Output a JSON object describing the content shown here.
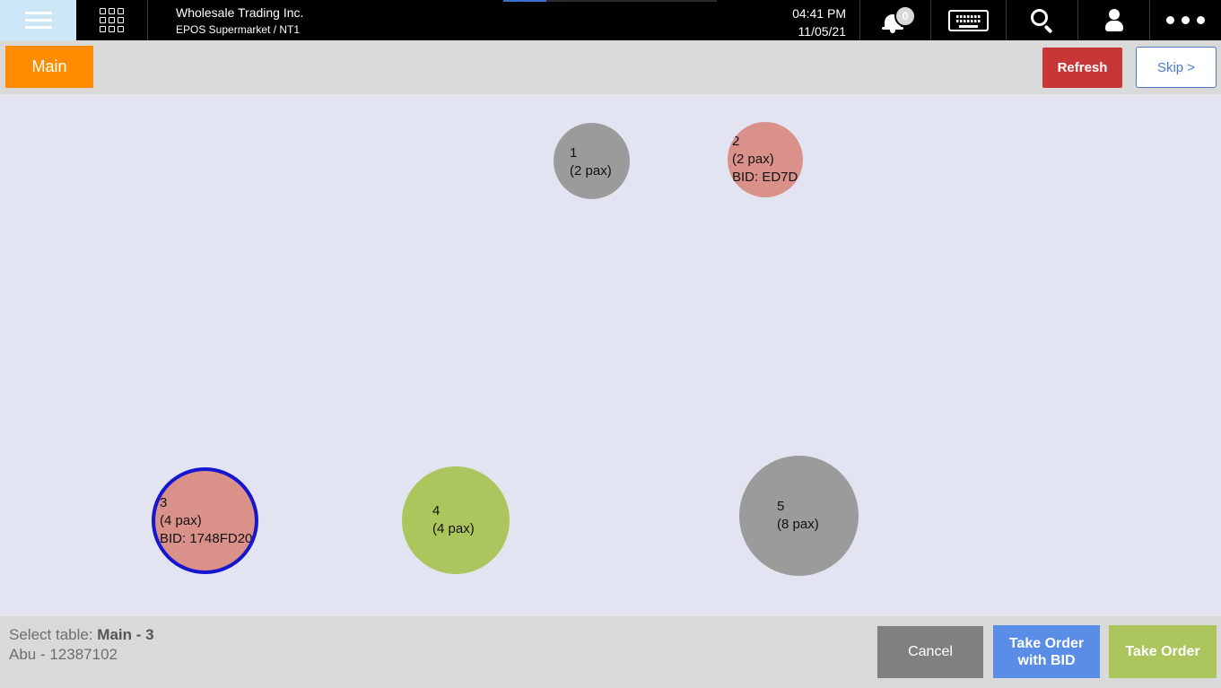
{
  "topbar": {
    "company_name": "Wholesale Trading Inc.",
    "company_subtitle": "EPOS Supermarket / NT1",
    "time": "04:41 PM",
    "date": "11/05/21",
    "notification_count": "0",
    "progress_fraction": 0.2,
    "icons": [
      "hamburger-icon",
      "app-grid-icon",
      "bell-icon",
      "keyboard-icon",
      "search-icon",
      "user-icon",
      "more-icon"
    ]
  },
  "area_bar": {
    "area_label": "Main",
    "refresh_label": "Refresh",
    "skip_label": "Skip >"
  },
  "tables": [
    {
      "number": "1",
      "pax": "(2 pax)",
      "bid": "",
      "status": "free"
    },
    {
      "number": "2",
      "pax": "(2 pax)",
      "bid": "BID: ED7D",
      "status": "occupied"
    },
    {
      "number": "3",
      "pax": "(4 pax)",
      "bid": "BID: 1748FD20",
      "status": "occupied",
      "selected": true
    },
    {
      "number": "4",
      "pax": "(4 pax)",
      "bid": "",
      "status": "available"
    },
    {
      "number": "5",
      "pax": "(8 pax)",
      "bid": "",
      "status": "free"
    }
  ],
  "footer": {
    "select_prefix": "Select table: ",
    "selected_table": "Main - 3",
    "customer": "Abu - 12387102",
    "cancel_label": "Cancel",
    "take_order_bid_label": "Take Order with BID",
    "take_order_label": "Take Order"
  },
  "colors": {
    "accent_orange": "#ff8c00",
    "refresh_red": "#c83737",
    "table_free": "#9b9b9b",
    "table_occupied": "#d9918a",
    "table_available": "#acc65d",
    "selected_border": "#1616d0",
    "bid_button": "#5a8de6"
  }
}
